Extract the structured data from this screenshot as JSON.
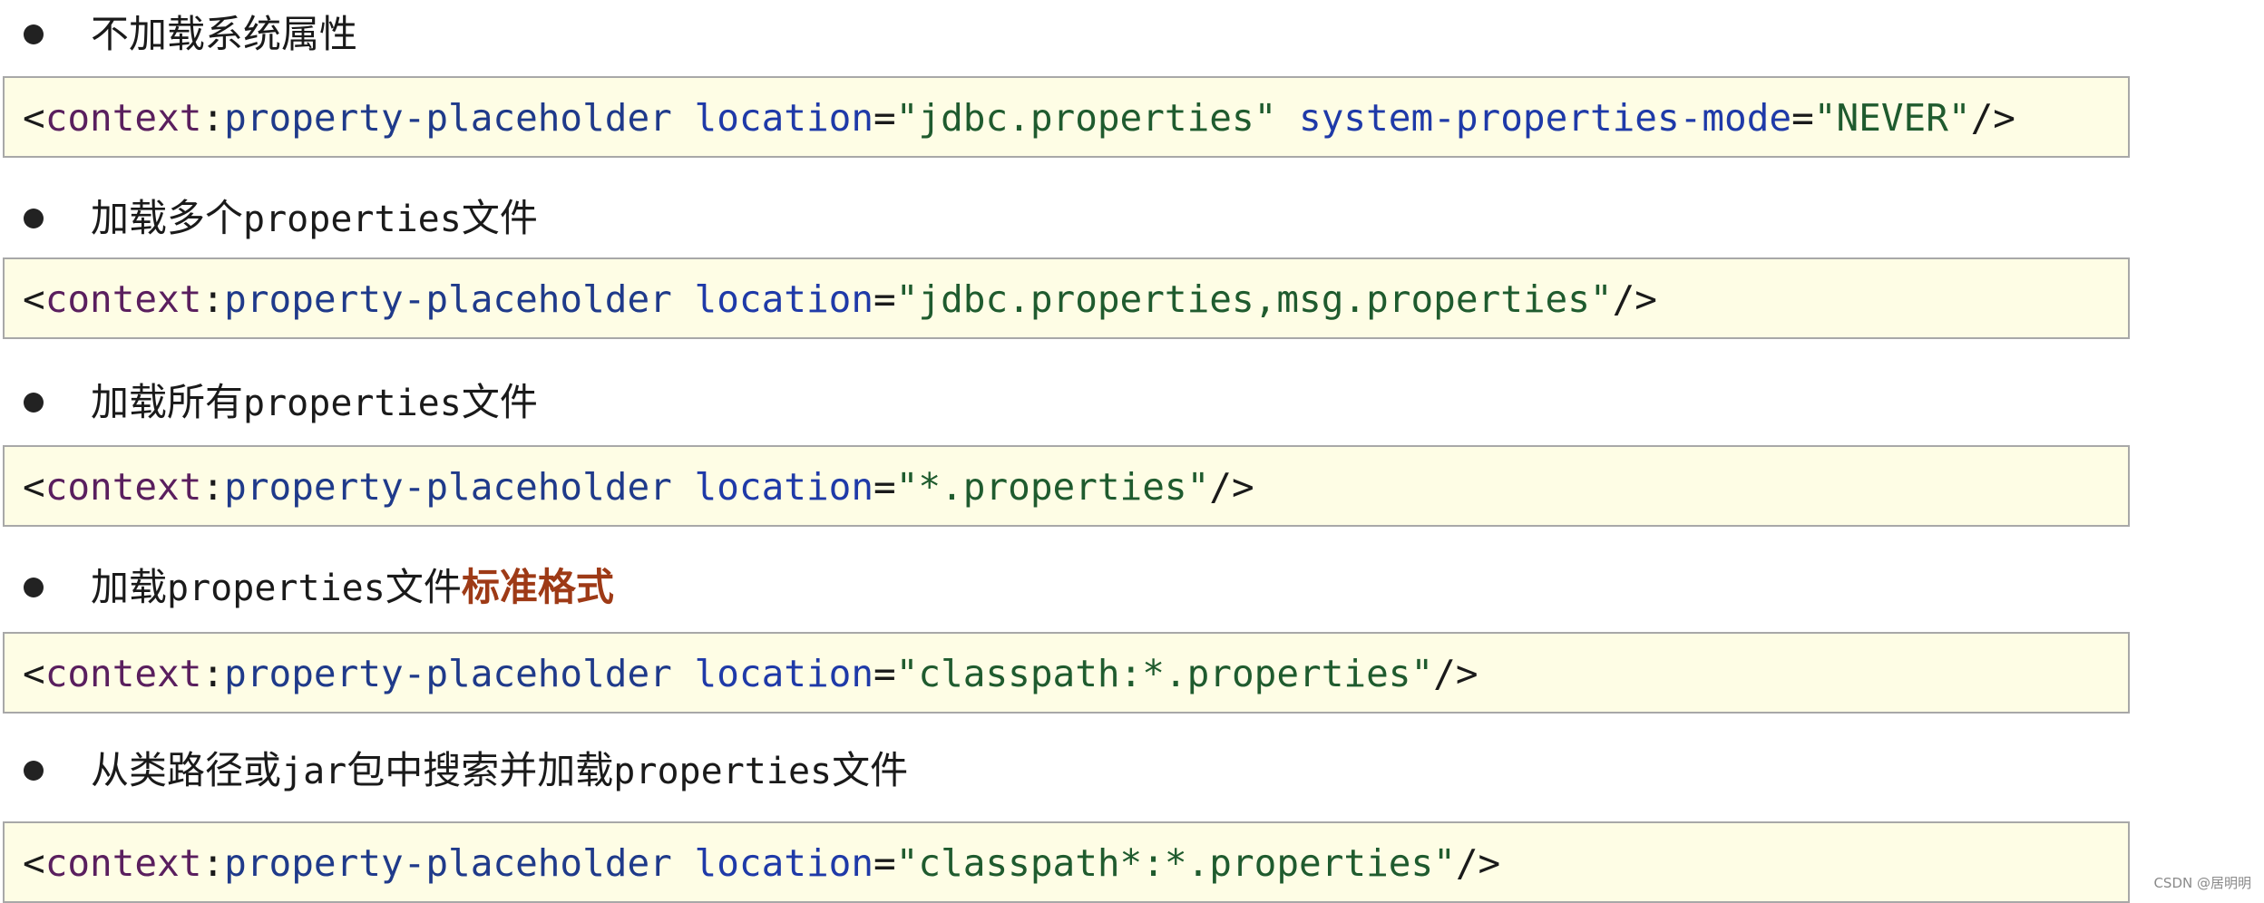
{
  "sections": [
    {
      "bullet": {
        "zh": "不加载系统属性"
      },
      "code": {
        "open": "<",
        "ns": "context",
        "colon": ":",
        "tag": "property-placeholder",
        "attr1": "location",
        "eq1": "=",
        "val1": "\"jdbc.properties\"",
        "attr2": "system-properties-mode",
        "eq2": "=",
        "val2": "\"NEVER\"",
        "close": "/>"
      }
    },
    {
      "bullet": {
        "zh1": "加载多个",
        "en": "properties",
        "zh2": "文件"
      },
      "code": {
        "open": "<",
        "ns": "context",
        "colon": ":",
        "tag": "property-placeholder",
        "attr1": "location",
        "eq1": "=",
        "val1": "\"jdbc.properties,msg.properties\"",
        "close": "/>"
      }
    },
    {
      "bullet": {
        "zh1": "加载所有",
        "en": "properties",
        "zh2": "文件"
      },
      "code": {
        "open": "<",
        "ns": "context",
        "colon": ":",
        "tag": "property-placeholder",
        "attr1": "location",
        "eq1": "=",
        "val1": "\"*.properties\"",
        "close": "/>"
      }
    },
    {
      "bullet": {
        "zh1": "加载",
        "en": "properties",
        "zh2": "文件",
        "highlight": "标准格式"
      },
      "code": {
        "open": "<",
        "ns": "context",
        "colon": ":",
        "tag": "property-placeholder",
        "attr1": "location",
        "eq1": "=",
        "val1": "\"classpath:*.properties\"",
        "close": "/>"
      }
    },
    {
      "bullet": {
        "zh1": "从类路径或",
        "en1": "jar",
        "zh2": "包中搜索并加载",
        "en2": "properties",
        "zh3": "文件"
      },
      "code": {
        "open": "<",
        "ns": "context",
        "colon": ":",
        "tag": "property-placeholder",
        "attr1": "location",
        "eq1": "=",
        "val1": "\"classpath*:*.properties\"",
        "close": "/>"
      }
    }
  ],
  "watermark": "CSDN @居明明",
  "colors": {
    "code_background": "#fefde5",
    "namespace": "#5a1f5e",
    "tag": "#1f3a8a",
    "attribute": "#1f3aa8",
    "value": "#1f5b2e",
    "highlight": "#9e3a16"
  }
}
